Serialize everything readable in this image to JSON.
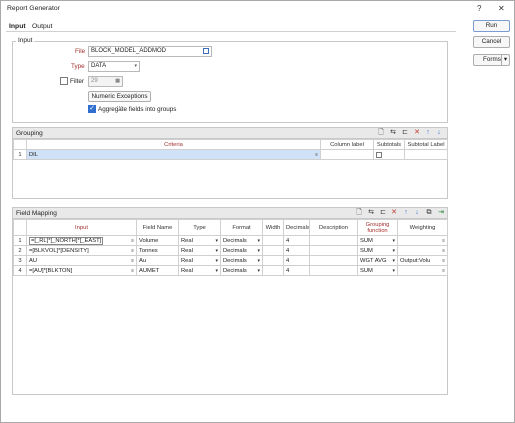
{
  "window": {
    "title": "Report Generator",
    "help": "?",
    "close": "✕"
  },
  "tabs": [
    {
      "label": "Input"
    },
    {
      "label": "Output"
    }
  ],
  "buttons": {
    "run": "Run",
    "cancel": "Cancel",
    "forms": "Forms",
    "forms_arrow": "▾"
  },
  "input_group": {
    "title": "Input",
    "file_label": "File",
    "file_value": "BLOCK_MODEL_ADDMOD",
    "type_label": "Type",
    "type_value": "DATA",
    "filter_label": "Filter",
    "filter_value": "29",
    "numeric_exceptions": "Numeric Exceptions ...",
    "aggregate_label": "Aggregate fields into groups",
    "aggregate_checked": true,
    "filter_checked": false
  },
  "grouping": {
    "title": "Grouping",
    "columns": {
      "criteria": "Criteria",
      "column_label": "Column label",
      "subtotals": "Subtotals",
      "subtotal_label": "Subtotal Label"
    },
    "rows": [
      {
        "num": "1",
        "criteria": "DIL",
        "column_label": "",
        "subtotal_label": ""
      }
    ]
  },
  "field_mapping": {
    "title": "Field Mapping",
    "columns": {
      "input": "Input",
      "field_name": "Field Name",
      "type": "Type",
      "format": "Format",
      "width": "Width",
      "decimals": "Decimals",
      "description": "Description",
      "grouping_function": "Grouping function",
      "weighting": "Weighting"
    },
    "rows": [
      {
        "num": "1",
        "input": "=[_RL]*[_NORTH]*[_EAST]",
        "field_name": "Volume",
        "type": "Real",
        "format": "Decimals",
        "width": "",
        "decimals": "4",
        "description": "",
        "grouping": "SUM",
        "weighting": ""
      },
      {
        "num": "2",
        "input": "=[BLKVOL]*[DENSITY]",
        "field_name": "Tonnes",
        "type": "Real",
        "format": "Decimals",
        "width": "",
        "decimals": "4",
        "description": "",
        "grouping": "SUM",
        "weighting": ""
      },
      {
        "num": "3",
        "input": "AU",
        "field_name": "Au",
        "type": "Real",
        "format": "Decimals",
        "width": "",
        "decimals": "4",
        "description": "",
        "grouping": "WGT AVG",
        "weighting": "Output:Volu"
      },
      {
        "num": "4",
        "input": "=[AU]*[BLKTON]",
        "field_name": "AUMET",
        "type": "Real",
        "format": "Decimals",
        "width": "",
        "decimals": "4",
        "description": "",
        "grouping": "SUM",
        "weighting": ""
      }
    ]
  },
  "icons": [
    "new-icon",
    "insert-icon",
    "insert-row-icon",
    "delete-icon",
    "move-up-icon",
    "move-down-icon",
    "copy-icon",
    "export-icon"
  ],
  "colors": {
    "required_label": "#a0302e",
    "selection": "#cfe2f7",
    "checkbox_on": "#2f6fd0"
  }
}
